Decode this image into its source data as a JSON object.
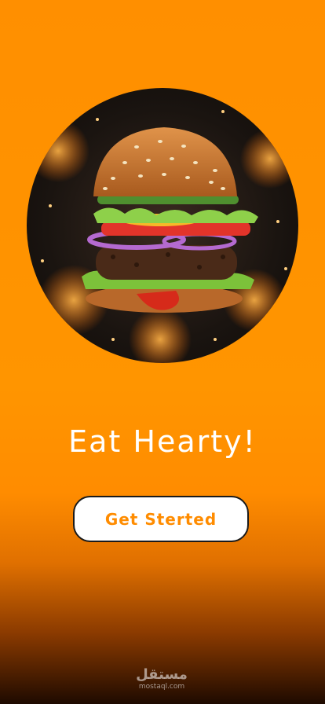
{
  "hero": {
    "image_alt": "Exploding burger"
  },
  "headline": "Eat Hearty!",
  "cta": {
    "label": "Get Sterted"
  },
  "watermark": {
    "logo": "مستقل",
    "domain": "mostaql.com"
  },
  "colors": {
    "accent": "#FF8C00",
    "background_top": "#FF8F00",
    "background_bottom": "#1E0A00",
    "button_bg": "#FFFFFF"
  },
  "icons": {
    "hero": "burger-image"
  }
}
